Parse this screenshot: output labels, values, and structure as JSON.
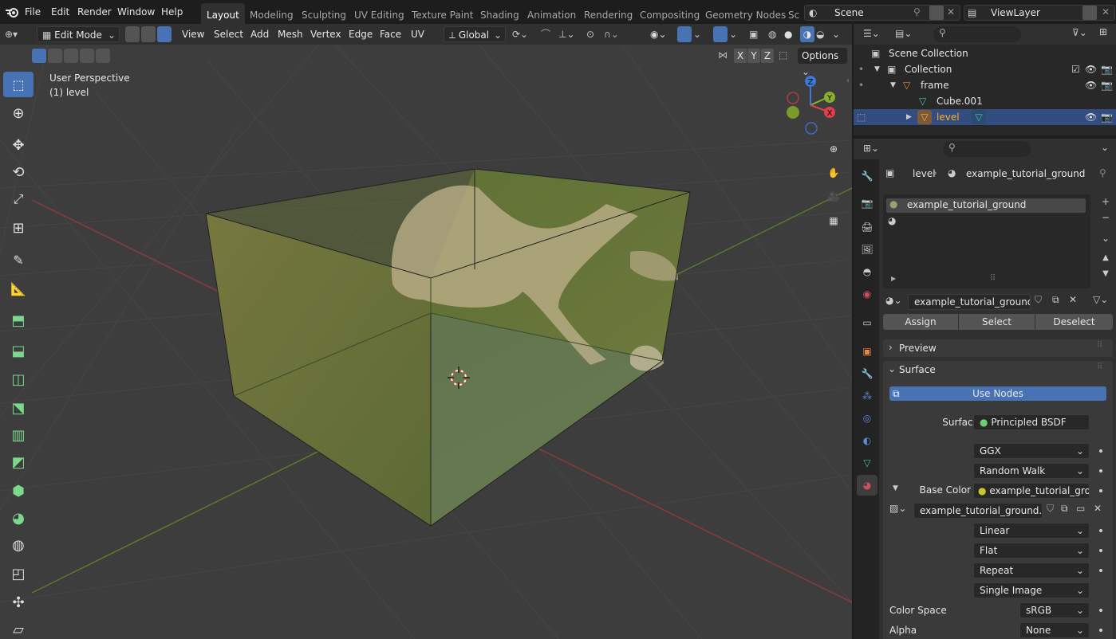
{
  "topbar": {
    "menus": [
      "File",
      "Edit",
      "Render",
      "Window",
      "Help"
    ],
    "workspaces": [
      "Layout",
      "Modeling",
      "Sculpting",
      "UV Editing",
      "Texture Paint",
      "Shading",
      "Animation",
      "Rendering",
      "Compositing",
      "Geometry Nodes",
      "Sc"
    ],
    "active_workspace": "Layout",
    "scene": "Scene",
    "view_layer": "ViewLayer"
  },
  "viewport_header": {
    "mode": "Edit Mode",
    "menus": [
      "View",
      "Select",
      "Add",
      "Mesh",
      "Vertex",
      "Edge",
      "Face",
      "UV"
    ],
    "transform_orientation": "Global",
    "axes": [
      "X",
      "Y",
      "Z"
    ],
    "options_label": "Options"
  },
  "viewport": {
    "perspective": "User Perspective",
    "object": "(1) level",
    "gizmo": {
      "x": "X",
      "y": "Y",
      "z": "Z"
    }
  },
  "outliner": {
    "rows": [
      {
        "label": "Scene Collection"
      },
      {
        "label": "Collection"
      },
      {
        "label": "frame"
      },
      {
        "label": "Cube.001"
      },
      {
        "label": "level"
      }
    ]
  },
  "properties": {
    "breadcrumb_object": "level",
    "breadcrumb_material": "example_tutorial_ground",
    "material_slot": "example_tutorial_ground",
    "material_name": "example_tutorial_ground",
    "assign": "Assign",
    "select": "Select",
    "deselect": "Deselect",
    "preview_panel": "Preview",
    "surface_panel": "Surface",
    "use_nodes": "Use Nodes",
    "surface_label": "Surface",
    "surface_value": "Principled BSDF",
    "distribution": "GGX",
    "subsurface_method": "Random Walk",
    "base_color_label": "Base Color",
    "base_color_value": "example_tutorial_grou...",
    "image_name": "example_tutorial_ground.tif",
    "interpolation": "Linear",
    "projection": "Flat",
    "extension": "Repeat",
    "source": "Single Image",
    "color_space_label": "Color Space",
    "color_space_value": "sRGB",
    "alpha_label": "Alpha",
    "alpha_value": "None"
  },
  "colors": {
    "accent": "#4772b3",
    "selected_row": "#334d80",
    "active_object": "#ffaf29",
    "grid_bg": "#3d3d3d"
  }
}
